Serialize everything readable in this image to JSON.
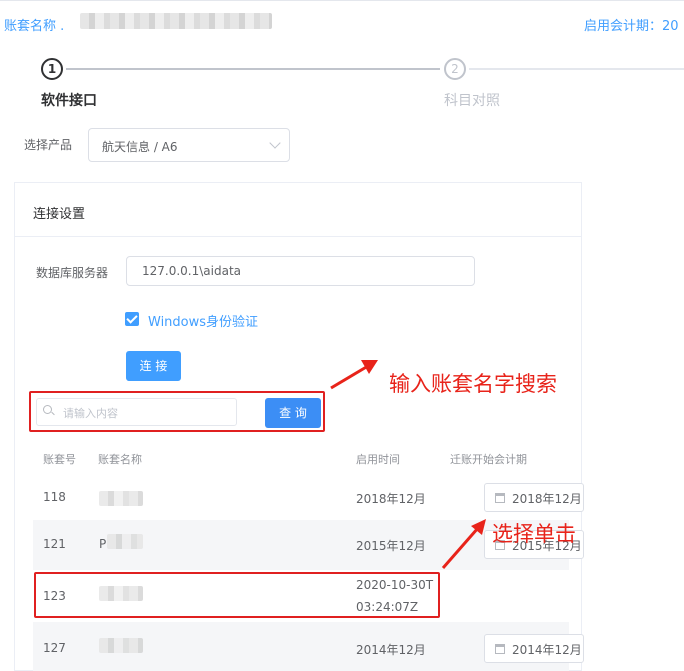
{
  "header": {
    "account_label": "账套名称 .",
    "period_label": "启用会计期：20"
  },
  "steps": [
    {
      "num": "1",
      "title": "软件接口"
    },
    {
      "num": "2",
      "title": "科目对照"
    }
  ],
  "product": {
    "label": "选择产品",
    "value": "航天信息 / A6"
  },
  "connection": {
    "title": "连接设置",
    "db_label": "数据库服务器",
    "db_value": "127.0.0.1\\aidata",
    "windows_auth": "Windows身份验证",
    "windows_auth_checked": true,
    "connect_btn": "连 接"
  },
  "search": {
    "placeholder": "请输入内容",
    "button": "查 询"
  },
  "annotations": {
    "search_tip": "输入账套名字搜索",
    "select_tip": "选择单击"
  },
  "table": {
    "columns": [
      "账套号",
      "账套名称",
      "启用时间",
      "迁账开始会计期"
    ],
    "rows": [
      {
        "id": "118",
        "name_prefix": "",
        "start": "2018年12月",
        "start2": "",
        "migrate": "2018年12月"
      },
      {
        "id": "121",
        "name_prefix": "P",
        "start": "2015年12月",
        "start2": "",
        "migrate": "2015年12月"
      },
      {
        "id": "123",
        "name_prefix": "",
        "start": "2020-10-30T",
        "start2": "03:24:07Z",
        "migrate": ""
      },
      {
        "id": "127",
        "name_prefix": "",
        "start": "2014年12月",
        "start2": "",
        "migrate": "2014年12月"
      }
    ]
  },
  "colors": {
    "primary": "#409eff",
    "annotation_red": "#e8231a"
  }
}
